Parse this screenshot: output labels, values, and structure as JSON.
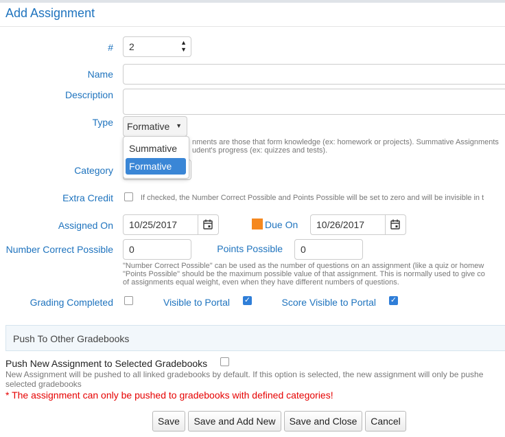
{
  "dialog": {
    "title": "Add Assignment"
  },
  "form": {
    "number": {
      "label": "#",
      "value": "2"
    },
    "name": {
      "label": "Name",
      "value": ""
    },
    "description": {
      "label": "Description",
      "value": ""
    },
    "type": {
      "label": "Type",
      "selected": "Formative",
      "options": [
        "Summative",
        "Formative"
      ],
      "hint_line1": "nments are those that form knowledge (ex: homework or projects). Summative Assignments",
      "hint_line2": "udent's progress (ex: quizzes and tests)."
    },
    "category": {
      "label": "Category"
    },
    "extra_credit": {
      "label": "Extra Credit",
      "checked": false,
      "hint": "If checked, the Number Correct Possible and Points Possible will be set to zero and will be invisible in t"
    },
    "assigned_on": {
      "label": "Assigned On",
      "value": "10/25/2017"
    },
    "due_on": {
      "label": "Due On",
      "value": "10/26/2017",
      "marker_color": "#f5881f"
    },
    "number_correct_possible": {
      "label": "Number Correct Possible",
      "value": "0"
    },
    "points_possible": {
      "label": "Points Possible",
      "value": "0"
    },
    "points_hint": [
      "\"Number Correct Possible\" can be used as the number of questions on an assignment (like a quiz or homew",
      "\"Points Possible\" should be the maximum possible value of that assignment. This is normally used to give co",
      "of assignments equal weight, even when they have different numbers of questions."
    ],
    "grading_completed": {
      "label": "Grading Completed",
      "checked": false
    },
    "visible_to_portal": {
      "label": "Visible to Portal",
      "checked": true
    },
    "score_visible_to_portal": {
      "label": "Score Visible to Portal",
      "checked": true
    }
  },
  "push": {
    "panel_title": "Push To Other Gradebooks",
    "selected_label": "Push New Assignment to Selected Gradebooks",
    "selected_checked": false,
    "hint_line1": "New Assignment will be pushed to all linked gradebooks by default. If this option is selected, the new assignment will only be pushe",
    "hint_line2": "selected gradebooks",
    "warning": "* The assignment can only be pushed to gradebooks with defined categories!"
  },
  "buttons": {
    "save": "Save",
    "save_add_new": "Save and Add New",
    "save_close": "Save and Close",
    "cancel": "Cancel"
  },
  "colors": {
    "label_blue": "#1e73be",
    "warning_red": "#e60000",
    "checkbox_blue": "#2f7ed8"
  }
}
